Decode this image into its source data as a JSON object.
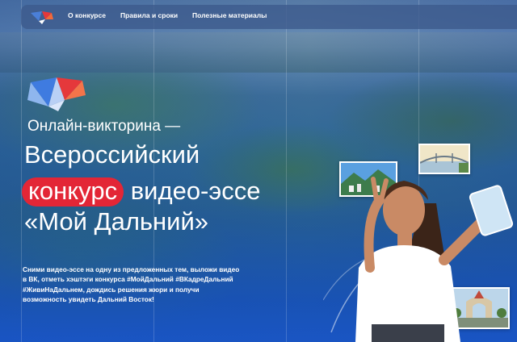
{
  "nav": {
    "items": [
      {
        "label": "О конкурсе"
      },
      {
        "label": "Правила и сроки"
      },
      {
        "label": "Полезные материалы"
      }
    ]
  },
  "hero": {
    "subtitle": "Онлайн-викторина —",
    "line1": "Всероссийский",
    "line2_highlight": "конкурс",
    "line2_rest": "видео-эссе",
    "line3": "«Мой Дальний»",
    "description_lines": [
      "Сними видео-эссе на одну из предложенных тем, выложи видео",
      "в ВК, отметь хэштэги конкурса #МойДальний #ВКадреДальний",
      "#ЖивиНаДальнем, дождись решения жюри и получи",
      "возможность увидеть Дальний Восток!"
    ]
  },
  "colors": {
    "accent_red": "#e32636",
    "nav_bg": "#3c5a8c",
    "brand_blue": "#1f5a9a"
  },
  "icons": {
    "logo": "origami-crystal-logo",
    "hero_logo": "origami-crystal-logo-large"
  }
}
